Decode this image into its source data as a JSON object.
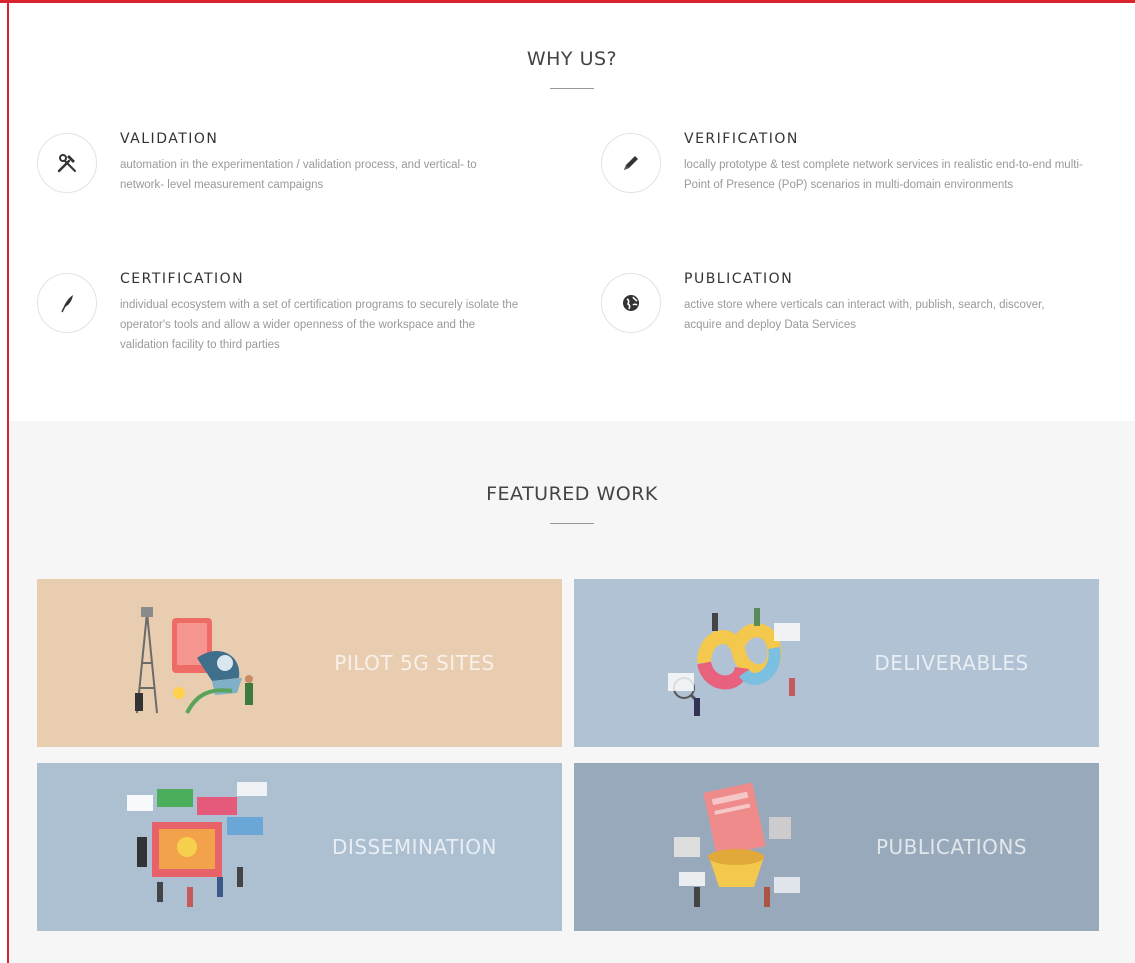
{
  "why_us": {
    "title": "WHY US?",
    "features": [
      {
        "icon": "tools-icon",
        "title": "VALIDATION",
        "text": "automation in the experimentation / validation process, and vertical- to network- level measurement campaigns"
      },
      {
        "icon": "pencil-icon",
        "title": "VERIFICATION",
        "text": "locally prototype & test complete network services in realistic end-to-end multi-Point of Presence (PoP) scenarios in multi-domain environments"
      },
      {
        "icon": "quill-icon",
        "title": "CERTIFICATION",
        "text": "individual ecosystem with a set of certification programs to securely isolate the operator's tools and allow a wider openness of the workspace and the validation facility to third parties"
      },
      {
        "icon": "globe-icon",
        "title": "PUBLICATION",
        "text": "active store where verticals can interact with, publish, search, discover, acquire and deploy Data Services"
      }
    ]
  },
  "featured_work": {
    "title": "FEATURED WORK",
    "tiles": [
      {
        "label": "PILOT 5G SITES",
        "color": "#e8cdb0"
      },
      {
        "label": "DELIVERABLES",
        "color": "#b0c2d3"
      },
      {
        "label": "DISSEMINATION",
        "color": "#adc0d2"
      },
      {
        "label": "PUBLICATIONS",
        "color": "#97a9ba"
      }
    ]
  }
}
